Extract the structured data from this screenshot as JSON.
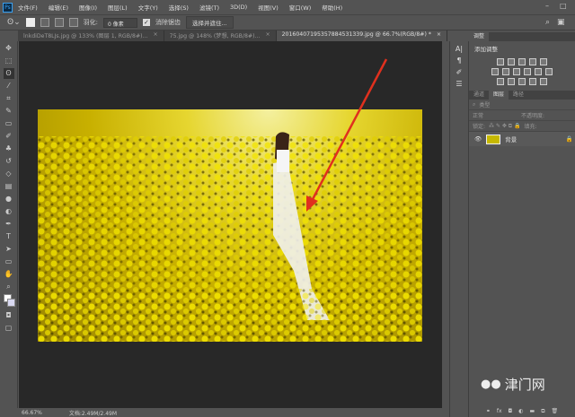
{
  "app": {
    "logo": "Ps"
  },
  "menu": [
    "文件(F)",
    "编辑(E)",
    "图像(I)",
    "图层(L)",
    "文字(Y)",
    "选择(S)",
    "滤镜(T)",
    "3D(D)",
    "视图(V)",
    "窗口(W)",
    "帮助(H)"
  ],
  "options": {
    "feather_label": "羽化:",
    "feather_value": "0 像素",
    "antialias_label": "消除锯齿",
    "select_mask_button": "选择并遮住..."
  },
  "tabs": [
    {
      "label": "lnkdiDeT8LJs.jpg @ 133% (图层 1, RGB/8#)...",
      "close": "×"
    },
    {
      "label": "75.jpg @ 148% (梦想, RGB/8#)...",
      "close": "×"
    },
    {
      "label": "20160407195357884531339.jpg @ 66.7%(RGB/8#) *",
      "close": "×"
    }
  ],
  "status": {
    "zoom": "66.67%",
    "doc": "文档:2.49M/2.49M"
  },
  "panels": {
    "adjust_tab": "调整",
    "add_adjust": "添加调整",
    "layer_tabs": [
      "通道",
      "图层",
      "路径"
    ],
    "kind": "类型",
    "blend": "正常",
    "opacity": "不透明度:",
    "lock": "锁定:",
    "fill": "填充:",
    "layer_name": "背景"
  },
  "watermark": "津门网",
  "colors": {
    "arrow": "#e0301e",
    "accent": "#3aa0f0"
  }
}
